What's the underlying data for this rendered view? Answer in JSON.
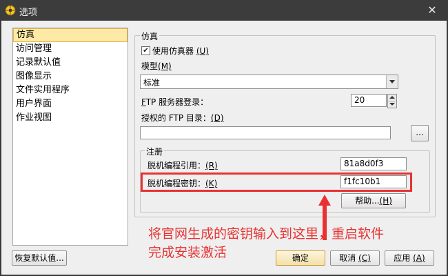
{
  "window": {
    "title": "选项",
    "close": "✕"
  },
  "nav": {
    "items": [
      {
        "label": "仿真",
        "selected": true
      },
      {
        "label": "访问管理"
      },
      {
        "label": "记录默认值"
      },
      {
        "label": "图像显示"
      },
      {
        "label": "文件实用程序"
      },
      {
        "label": "用户界面"
      },
      {
        "label": "作业视图"
      }
    ]
  },
  "sim": {
    "legend": "仿真",
    "use_emulator_label": "使用仿真器 ",
    "use_emulator_key": "(U)",
    "use_emulator_checked": true,
    "model_label": "模型",
    "model_key": "(M)",
    "model_value": "标准",
    "ftp_login_prefix": "F",
    "ftp_login_label": "TP 服务器登录：",
    "ftp_login_value": "20",
    "ftp_dir_label": "授权的 FTP 目录：",
    "ftp_dir_key": "(D)",
    "ftp_dir_value": "",
    "browse_label": "...",
    "reg": {
      "legend": "注册",
      "offline_ref_label": "脱机编程引用：",
      "offline_ref_key": "(R)",
      "offline_ref_value": "81a8d0f3",
      "offline_key_label": "脱机编程密钥：",
      "offline_key_key": "(K)",
      "offline_key_value": "f1fc10b1",
      "help_label": "帮助...",
      "help_key": "(H)"
    }
  },
  "buttons": {
    "restore_defaults": "恢复默认值...",
    "ok": "确定",
    "cancel": "取消",
    "cancel_key": "(C)",
    "apply": "应用",
    "apply_key": "(A)"
  },
  "annotation": {
    "line1": "将官网生成的密钥输入到这里，重启软件",
    "line2": "完成安装激活",
    "color": "#e83232"
  }
}
